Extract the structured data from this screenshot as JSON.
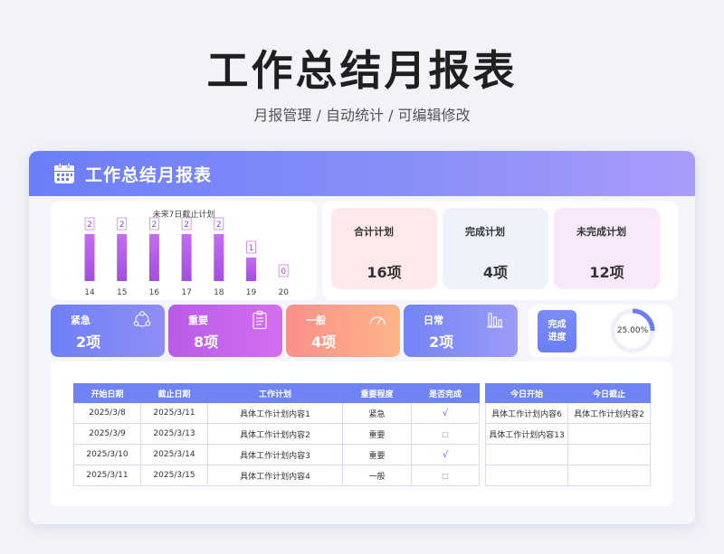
{
  "page": {
    "title": "工作总结月报表",
    "subtitle": "月报管理 / 自动统计 /  可编辑修改"
  },
  "header": {
    "title": "工作总结月报表",
    "icon": "calendar-icon"
  },
  "chart_data": {
    "type": "bar",
    "title": "未来7日截止计划",
    "categories": [
      "14",
      "15",
      "16",
      "17",
      "18",
      "19",
      "20"
    ],
    "values": [
      2,
      2,
      2,
      2,
      2,
      1,
      0
    ],
    "ylim": [
      0,
      2
    ],
    "colors": {
      "bar_top": "#c56cf0",
      "bar_bottom": "#a24ee0",
      "label_border": "#d27cf0"
    }
  },
  "stats": [
    {
      "label": "合计计划",
      "value": "16项",
      "bg": "#fde9ea"
    },
    {
      "label": "完成计划",
      "value": "4项",
      "bg": "#eef2fb"
    },
    {
      "label": "未完成计划",
      "value": "12项",
      "bg": "#f9e8fa"
    }
  ],
  "categories": [
    {
      "label": "紧急",
      "value": "2项",
      "icon": "share-icon"
    },
    {
      "label": "重要",
      "value": "8项",
      "icon": "clipboard-icon"
    },
    {
      "label": "一般",
      "value": "4项",
      "icon": "gauge-icon"
    },
    {
      "label": "日常",
      "value": "2项",
      "icon": "bar-chart-icon"
    }
  ],
  "progress": {
    "label_line1": "完成",
    "label_line2": "进度",
    "value": "25.00%",
    "fraction": 0.25,
    "color": "#6b7ef7"
  },
  "plan_table": {
    "headers": [
      "开始日期",
      "截止日期",
      "工作计划",
      "重要程度",
      "是否完成"
    ],
    "rows": [
      [
        "2025/3/8",
        "2025/3/11",
        "具体工作计划内容1",
        "紧急",
        "√"
      ],
      [
        "2025/3/9",
        "2025/3/13",
        "具体工作计划内容2",
        "重要",
        "□"
      ],
      [
        "2025/3/10",
        "2025/3/14",
        "具体工作计划内容3",
        "重要",
        "√"
      ],
      [
        "2025/3/11",
        "2025/3/15",
        "具体工作计划内容4",
        "一般",
        "□"
      ]
    ]
  },
  "today_table": {
    "headers": [
      "今日开始",
      "今日截止"
    ],
    "rows": [
      [
        "具体工作计划内容6",
        "具体工作计划内容2"
      ],
      [
        "具体工作计划内容13",
        ""
      ],
      [
        "",
        ""
      ],
      [
        "",
        ""
      ]
    ]
  }
}
